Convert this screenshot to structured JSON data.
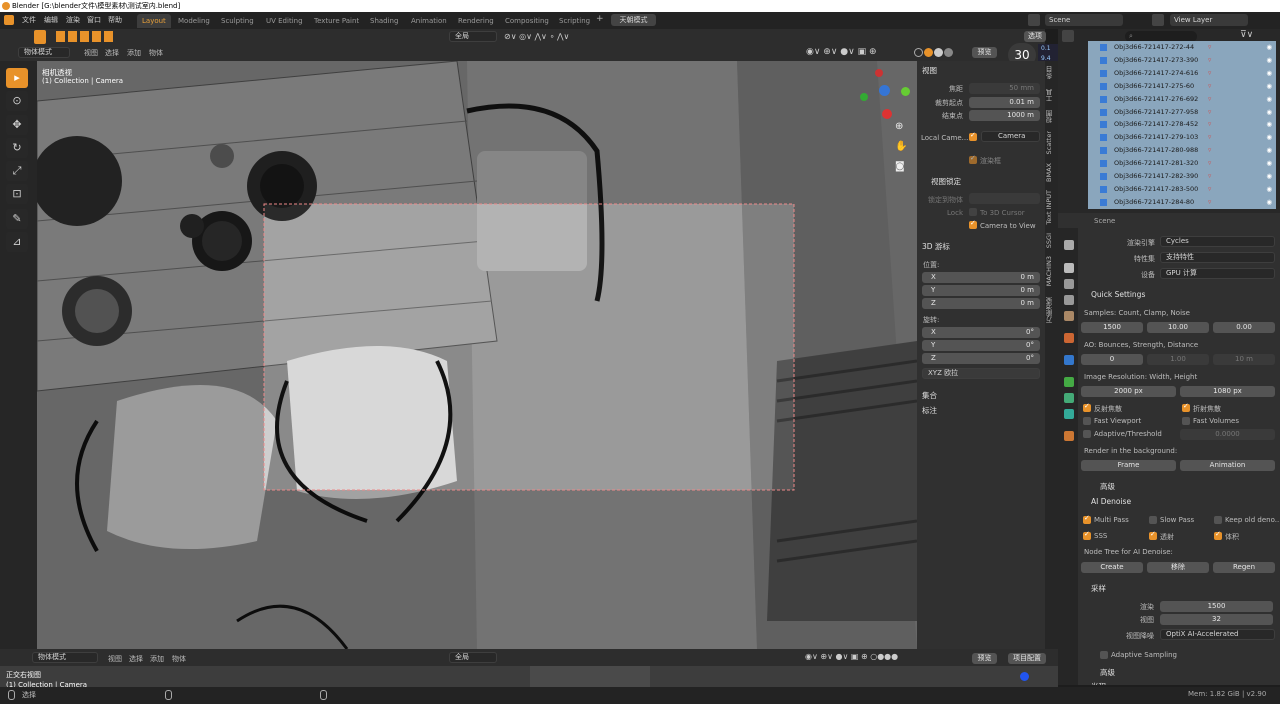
{
  "title": "Blender [G:\\blender文件\\模型素材\\测试室内.blend]",
  "menu": [
    "文件",
    "编辑",
    "渲染",
    "窗口",
    "帮助"
  ],
  "workspaces": [
    "Layout",
    "Modeling",
    "Sculpting",
    "UV Editing",
    "Texture Paint",
    "Shading",
    "Animation",
    "Rendering",
    "Compositing",
    "Scripting"
  ],
  "tianchuang": "天朝模式",
  "scene_name": "Scene",
  "view_layer": "View Layer",
  "viewport_header": {
    "mode": "物体模式",
    "items": [
      "视图",
      "选择",
      "添加",
      "物体"
    ],
    "global": "全局",
    "preview": "预览",
    "options": "选项"
  },
  "viewport_overlay": {
    "title": "相机透视",
    "subtitle": "(1) Collection | Camera",
    "fps": "30",
    "fps_small": [
      "0.1",
      "9.4"
    ]
  },
  "npanel": {
    "view_section": "视图",
    "focal_label": "焦距",
    "focal": "50 mm",
    "clip_start_label": "裁剪起点",
    "clip_start": "0.01 m",
    "clip_end_label": "结束点",
    "clip_end": "1000 m",
    "local_camera_label": "Local Came...",
    "local_camera": "Camera",
    "render_border": "渲染框",
    "view_lock_section": "视图锁定",
    "lock_to_object": "锁定到物体",
    "lock": "Lock",
    "to_3d_cursor": "To 3D Cursor",
    "camera_to_view": "Camera to View",
    "cursor_section": "3D 游标",
    "location": "位置:",
    "rotation": "旋转:",
    "loc": [
      {
        "axis": "X",
        "val": "0 m"
      },
      {
        "axis": "Y",
        "val": "0 m"
      },
      {
        "axis": "Z",
        "val": "0 m"
      }
    ],
    "rot": [
      {
        "axis": "X",
        "val": "0°"
      },
      {
        "axis": "Y",
        "val": "0°"
      },
      {
        "axis": "Z",
        "val": "0°"
      }
    ],
    "rot_mode": "XYZ 欧拉",
    "collection": "集合",
    "annotation": "标注"
  },
  "tabs": [
    "条目",
    "工具",
    "视图",
    "Scatter",
    "BMAX",
    "Text INPUT",
    "SSGI",
    "MACHIN3",
    "万能渲染"
  ],
  "outliner": [
    "Obj3d66-721417-272-44",
    "Obj3d66-721417-273-390",
    "Obj3d66-721417-274-616",
    "Obj3d66-721417-275-60",
    "Obj3d66-721417-276-692",
    "Obj3d66-721417-277-958",
    "Obj3d66-721417-278-452",
    "Obj3d66-721417-279-103",
    "Obj3d66-721417-280-988",
    "Obj3d66-721417-281-320",
    "Obj3d66-721417-282-390",
    "Obj3d66-721417-283-500",
    "Obj3d66-721417-284-80"
  ],
  "props": {
    "scene": "Scene",
    "engine_label": "渲染引擎",
    "engine": "Cycles",
    "feature_label": "特性集",
    "feature": "支持特性",
    "device_label": "设备",
    "device": "GPU 计算",
    "quick": "Quick Settings",
    "samples_label": "Samples: Count, Clamp, Noise",
    "samples": [
      "1500",
      "10.00",
      "0.00"
    ],
    "ao_label": "AO: Bounces, Strength, Distance",
    "ao": [
      "0",
      "1.00",
      "10 m"
    ],
    "res_label": "Image Resolution: Width, Height",
    "res": [
      "2000 px",
      "1080 px"
    ],
    "reflect": "反射焦散",
    "refract": "折射焦散",
    "fast_vp": "Fast Viewport",
    "fast_vol": "Fast Volumes",
    "adaptive": "Adaptive/Threshold",
    "adaptive_val": "0.0000",
    "bg_label": "Render in the background:",
    "frame": "Frame",
    "animation": "Animation",
    "advanced": "高级",
    "denoise": "AI Denoise",
    "multipass": "Multi Pass",
    "slowpass": "Slow Pass",
    "keepold": "Keep old deno...",
    "sss": "SSS",
    "transmit": "透射",
    "volume": "体积",
    "node_tree": "Node Tree for AI Denoise:",
    "create": "Create",
    "remove": "移除",
    "regen": "Regen",
    "sampling": "采样",
    "render_label": "渲染",
    "render_val": "1500",
    "viewport_label": "视图",
    "viewport_val": "32",
    "vp_denoise_label": "视图降噪",
    "vp_denoise": "OptiX AI-Accelerated",
    "adaptive_sampling": "Adaptive Sampling",
    "advanced2": "高级",
    "light_paths": "光程"
  },
  "bottom_header": {
    "mode": "物体模式",
    "items": [
      "视图",
      "选择",
      "添加",
      "物体"
    ],
    "global": "全局",
    "preview": "预览",
    "project": "项目配置"
  },
  "bottom_view": {
    "title": "正交右视图",
    "subtitle": "(1) Collection | Camera"
  },
  "status": {
    "select": "选择",
    "memory": "Mem: 1.82 GiB | v2.90"
  },
  "colors": {
    "accent": "#e8922a",
    "selected_row": "#8aa6bd"
  }
}
